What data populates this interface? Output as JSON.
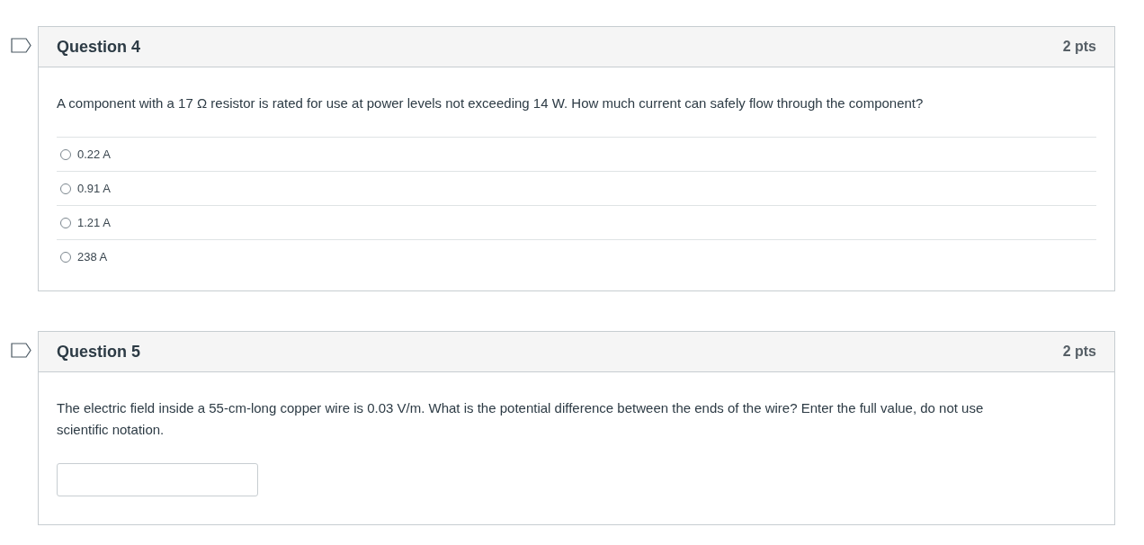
{
  "questions": [
    {
      "kind": "multiple_choice",
      "flagged": false,
      "title": "Question 4",
      "points": "2 pts",
      "text": "A component with a 17 Ω resistor is rated for use at power levels not exceeding 14 W. How much current can safely flow through the component?",
      "options": [
        {
          "label": "0.22 A",
          "selected": false
        },
        {
          "label": "0.91 A",
          "selected": false
        },
        {
          "label": "1.21 A",
          "selected": false
        },
        {
          "label": "238 A",
          "selected": false
        }
      ]
    },
    {
      "kind": "short_answer",
      "flagged": false,
      "title": "Question 5",
      "points": "2 pts",
      "text": "The electric field inside a 55-cm-long copper wire is 0.03 V/m. What is the potential difference between the ends of the wire? Enter the full value, do not use scientific notation."
    }
  ]
}
